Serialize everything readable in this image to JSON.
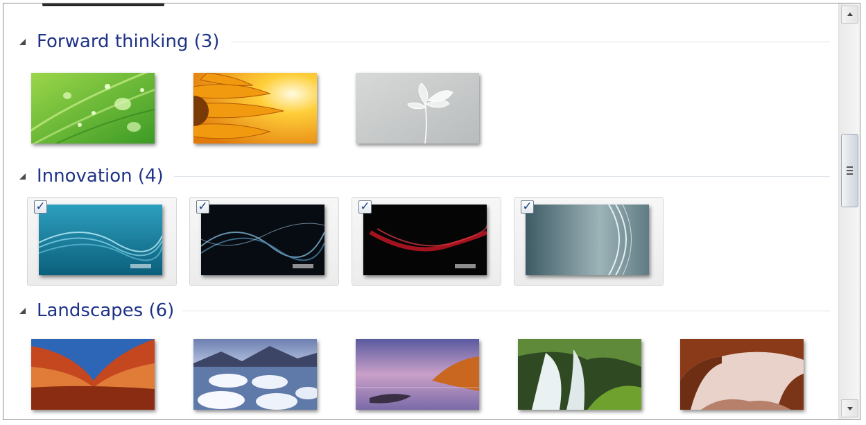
{
  "groups": [
    {
      "title": "Forward thinking (3)",
      "items": [
        {
          "name": "Green leaf with droplets",
          "selected": false
        },
        {
          "name": "Orange sunflower",
          "selected": false
        },
        {
          "name": "Glass flower",
          "selected": false
        }
      ]
    },
    {
      "title": "Innovation (4)",
      "items": [
        {
          "name": "Teal waves",
          "selected": true
        },
        {
          "name": "Blue streaks",
          "selected": true
        },
        {
          "name": "Red streak",
          "selected": true
        },
        {
          "name": "Grey swirl",
          "selected": true
        }
      ]
    },
    {
      "title": "Landscapes (6)",
      "items": [
        {
          "name": "Red rock canyon",
          "selected": false
        },
        {
          "name": "Ice lake",
          "selected": false
        },
        {
          "name": "Coast sunset",
          "selected": false
        },
        {
          "name": "Waterfall",
          "selected": false
        },
        {
          "name": "Rock arch",
          "selected": false
        }
      ]
    }
  ],
  "checkmark": "✓",
  "icons": {
    "collapse": "collapse-arrow-icon",
    "scroll_up": "scroll-up-arrow-icon",
    "scroll_down": "scroll-down-arrow-icon",
    "checkbox": "checkbox-icon"
  },
  "colors": {
    "group_title": "#1e3287",
    "selected_tile_border": "#d3d7dc"
  }
}
